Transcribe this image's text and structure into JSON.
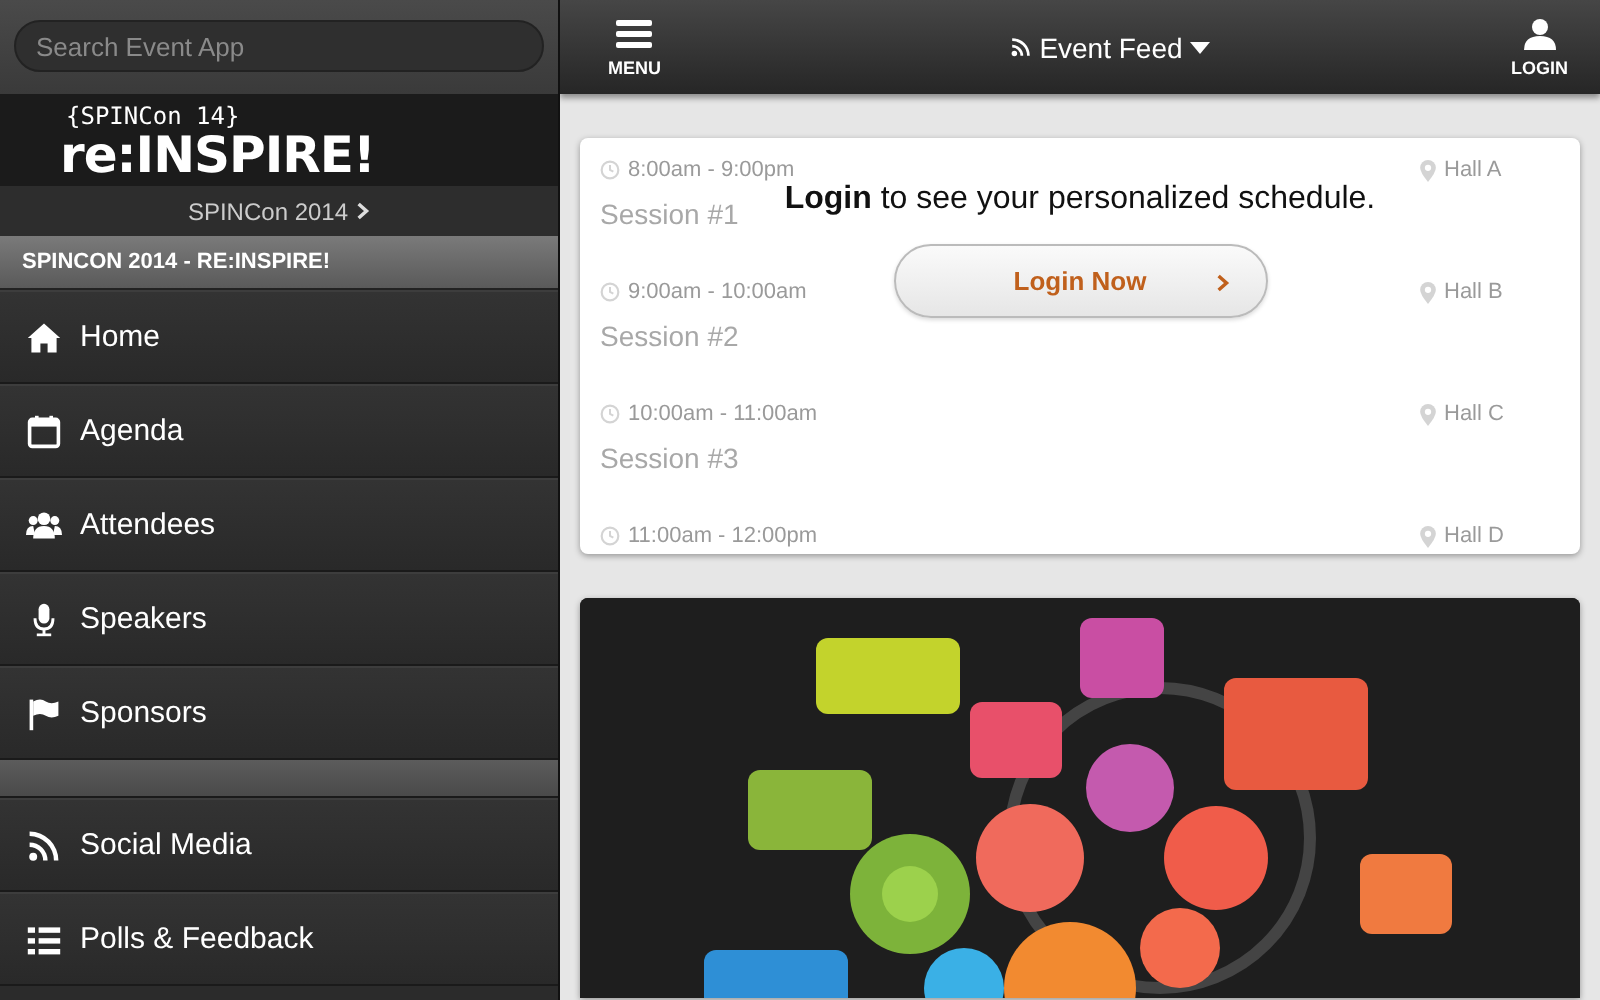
{
  "search": {
    "placeholder": "Search Event App"
  },
  "banner": {
    "tagline": "{SPINCon 14}",
    "logo": "re:INSPIRE!",
    "event_link": "SPINCon 2014"
  },
  "section_header": "SPINCON 2014 - RE:INSPIRE!",
  "menu_primary": [
    {
      "label": "Home"
    },
    {
      "label": "Agenda"
    },
    {
      "label": "Attendees"
    },
    {
      "label": "Speakers"
    },
    {
      "label": "Sponsors"
    }
  ],
  "menu_secondary": [
    {
      "label": "Social Media"
    },
    {
      "label": "Polls & Feedback"
    }
  ],
  "top_bar": {
    "menu_label": "MENU",
    "title": "Event Feed",
    "login_label": "LOGIN"
  },
  "schedule": {
    "sessions": [
      {
        "time": "8:00am - 9:00pm",
        "title": "Session #1",
        "location": "Hall A"
      },
      {
        "time": "9:00am - 10:00am",
        "title": "Session #2",
        "location": "Hall B"
      },
      {
        "time": "10:00am - 11:00am",
        "title": "Session #3",
        "location": "Hall C"
      },
      {
        "time": "11:00am - 12:00pm",
        "location": "Hall D"
      }
    ],
    "prompt": "**Login** to see your personalized schedule.",
    "button": "Login Now"
  }
}
